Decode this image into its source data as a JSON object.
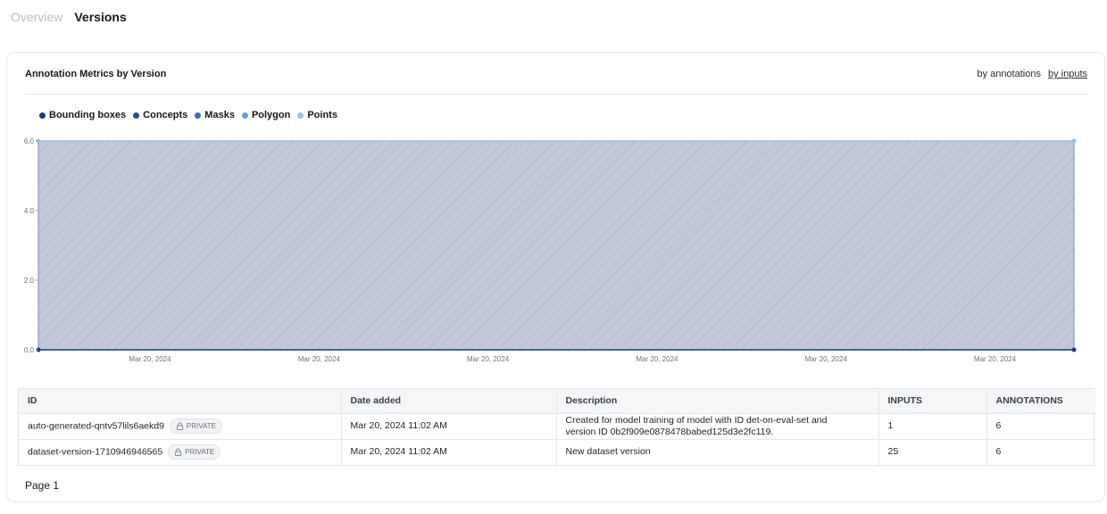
{
  "tabs": [
    {
      "label": "Overview",
      "active": false
    },
    {
      "label": "Versions",
      "active": true
    }
  ],
  "card": {
    "title": "Annotation Metrics by Version",
    "toggle": {
      "option1": "by annotations",
      "option2": "by inputs",
      "selected": "by inputs"
    }
  },
  "legend": [
    {
      "label": "Bounding boxes",
      "color": "#1b3c73"
    },
    {
      "label": "Concepts",
      "color": "#244f94"
    },
    {
      "label": "Masks",
      "color": "#3f6db0"
    },
    {
      "label": "Polygon",
      "color": "#6f9bd0"
    },
    {
      "label": "Points",
      "color": "#9ec2e6"
    }
  ],
  "chart_data": {
    "type": "area",
    "x_tick_labels": [
      "Mar 20, 2024",
      "Mar 20, 2024",
      "Mar 20, 2024",
      "Mar 20, 2024",
      "Mar 20, 2024",
      "Mar 20, 2024"
    ],
    "y_tick_labels": [
      "0.0",
      "2.0",
      "4.0",
      "6.0"
    ],
    "ylim": [
      0,
      6
    ],
    "series": [
      {
        "name": "Points",
        "values": [
          6,
          6
        ]
      },
      {
        "name": "Bounding boxes",
        "values": [
          0,
          0
        ]
      }
    ],
    "fill_color": "#c3c9da",
    "stroke_top": "#9ec2e6",
    "stroke_bottom": "#1b3c73",
    "grid": false
  },
  "table": {
    "headers": [
      "ID",
      "Date added",
      "Description",
      "INPUTS",
      "ANNOTATIONS"
    ],
    "rows": [
      {
        "id": "auto-generated-qntv57lils6aekd9",
        "badge": "PRIVATE",
        "date": "Mar 20, 2024 11:02 AM",
        "description_line1": "Created for model training of model with ID det-on-eval-set and",
        "description_line2": "version ID 0b2f909e0878478babed125d3e2fc119.",
        "inputs": "1",
        "annotations": "6"
      },
      {
        "id": "dataset-version-1710946946565",
        "badge": "PRIVATE",
        "date": "Mar 20, 2024 11:02 AM",
        "description_line1": "New dataset version",
        "description_line2": "",
        "inputs": "25",
        "annotations": "6"
      }
    ]
  },
  "pagination": {
    "label": "Page 1"
  }
}
